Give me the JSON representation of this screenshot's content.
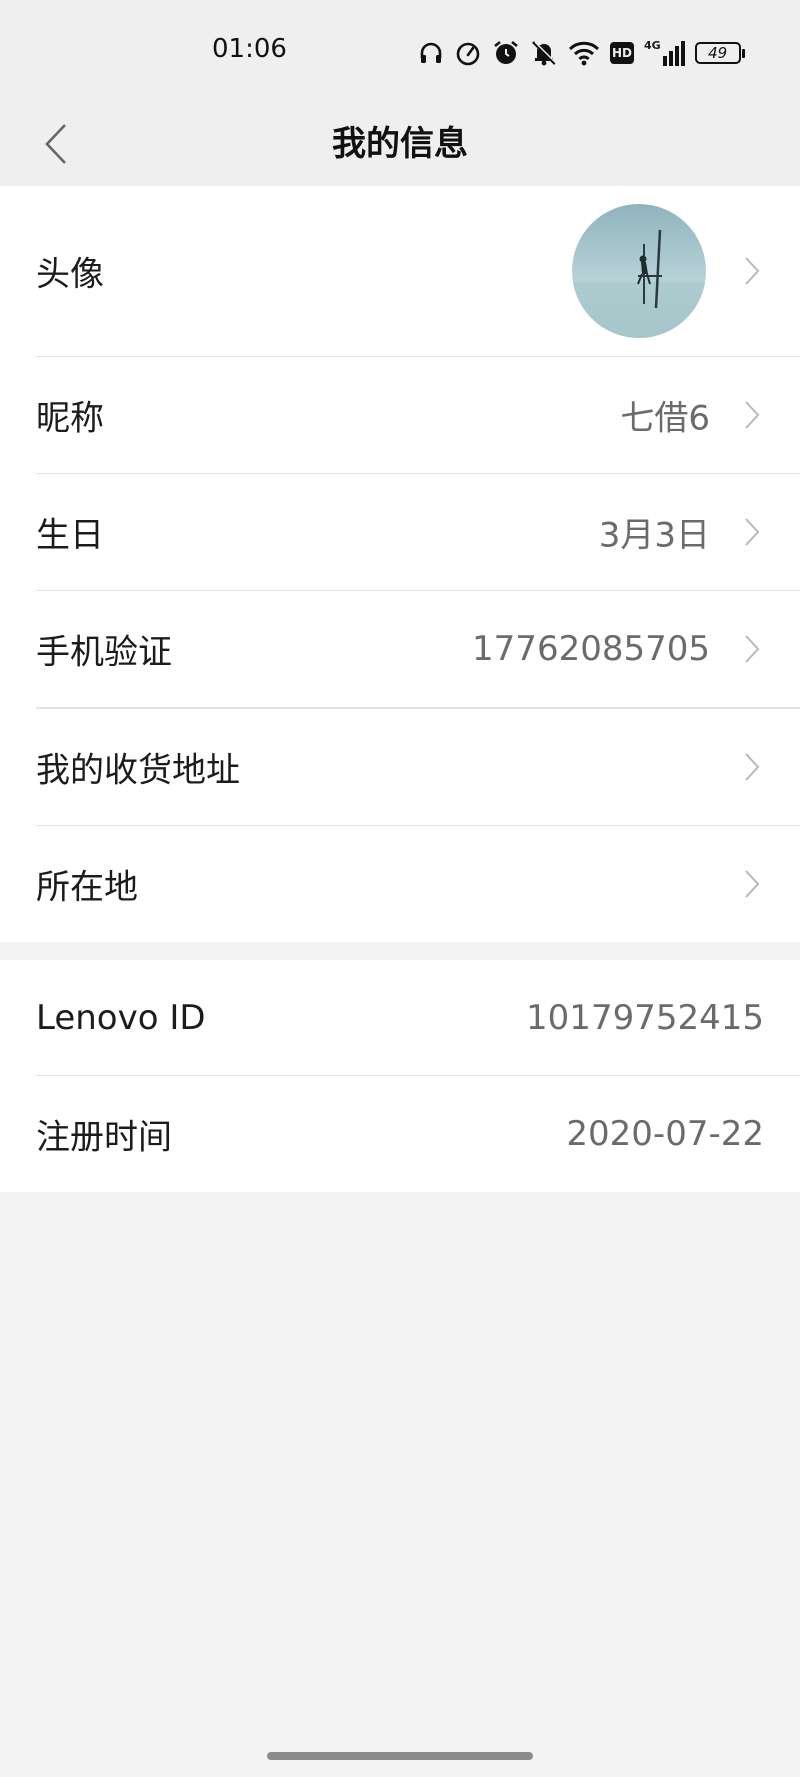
{
  "status_bar": {
    "time": "01:06",
    "battery": "49",
    "network": "4G",
    "hd": "HD",
    "icons": [
      "headphones-icon",
      "speedometer-icon",
      "alarm-icon",
      "mute-bell-icon",
      "wifi-icon",
      "hd-icon",
      "signal-4g-icon",
      "battery-icon"
    ]
  },
  "header": {
    "title": "我的信息",
    "back_icon": "chevron-left-icon"
  },
  "profile": {
    "avatar_label": "头像",
    "rows": [
      {
        "label": "昵称",
        "value": "七借6"
      },
      {
        "label": "生日",
        "value": "3月3日"
      },
      {
        "label": "手机验证",
        "value": "17762085705"
      },
      {
        "label": "我的收货地址",
        "value": ""
      },
      {
        "label": "所在地",
        "value": ""
      }
    ]
  },
  "account": {
    "rows": [
      {
        "label": "Lenovo ID",
        "value": "10179752415"
      },
      {
        "label": "注册时间",
        "value": "2020-07-22"
      }
    ]
  },
  "colors": {
    "background": "#f4f4f4",
    "card": "#ffffff",
    "value_text": "#6b6b6b",
    "divider": "#e3e3e3"
  }
}
